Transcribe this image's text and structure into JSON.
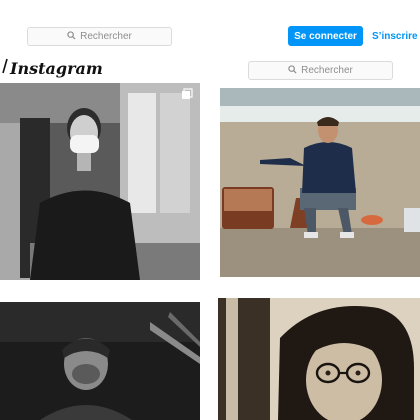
{
  "header": {
    "search_placeholder": "Rechercher",
    "login_label": "Se connecter",
    "signup_label": "S’inscrire"
  },
  "brand": {
    "logo_text": "Instagram"
  },
  "second_search": {
    "placeholder": "Rechercher"
  },
  "colors": {
    "accent": "#0095f6",
    "border": "#dbdbdb",
    "placeholder": "#8e8e8e"
  },
  "icons": [
    "search-icon",
    "instagram-glyph-icon",
    "carousel-icon"
  ]
}
